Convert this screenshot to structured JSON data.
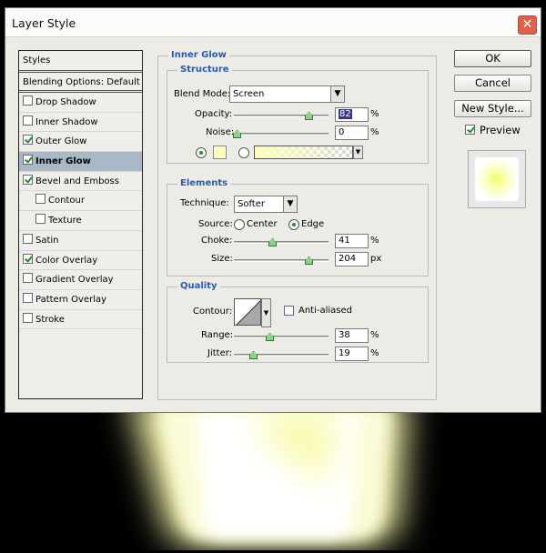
{
  "dialog": {
    "title": "Layer Style",
    "close_glyph": "✕"
  },
  "styles_list": {
    "header": "Styles",
    "blending_options": "Blending Options: Default",
    "items": [
      {
        "label": "Drop Shadow",
        "checked": false
      },
      {
        "label": "Inner Shadow",
        "checked": false
      },
      {
        "label": "Outer Glow",
        "checked": true
      },
      {
        "label": "Inner Glow",
        "checked": true,
        "selected": true
      },
      {
        "label": "Bevel and Emboss",
        "checked": true
      },
      {
        "label": "Contour",
        "checked": false,
        "indent": true
      },
      {
        "label": "Texture",
        "checked": false,
        "indent": true
      },
      {
        "label": "Satin",
        "checked": false
      },
      {
        "label": "Color Overlay",
        "checked": true
      },
      {
        "label": "Gradient Overlay",
        "checked": false
      },
      {
        "label": "Pattern Overlay",
        "checked": false
      },
      {
        "label": "Stroke",
        "checked": false
      }
    ]
  },
  "inner_glow": {
    "title": "Inner Glow",
    "structure": {
      "title": "Structure",
      "blend_mode_label": "Blend Mode:",
      "blend_mode_value": "Screen",
      "opacity_label": "Opacity:",
      "opacity_value": "82",
      "noise_label": "Noise:",
      "noise_value": "0",
      "percent": "%",
      "swatch_color": "#ffffb8"
    },
    "elements": {
      "title": "Elements",
      "technique_label": "Technique:",
      "technique_value": "Softer",
      "source_label": "Source:",
      "source_center": "Center",
      "source_edge": "Edge",
      "choke_label": "Choke:",
      "choke_value": "41",
      "size_label": "Size:",
      "size_value": "204",
      "percent": "%",
      "px": "px"
    },
    "quality": {
      "title": "Quality",
      "contour_label": "Contour:",
      "anti_aliased_label": "Anti-aliased",
      "range_label": "Range:",
      "range_value": "38",
      "jitter_label": "Jitter:",
      "jitter_value": "19",
      "percent": "%"
    }
  },
  "buttons": {
    "ok": "OK",
    "cancel": "Cancel",
    "new_style": "New Style...",
    "preview_label": "Preview"
  },
  "colors": {
    "section_title": "#2b5bb0",
    "selected_row": "#a8b8c6",
    "glow": "#ffffb8"
  }
}
